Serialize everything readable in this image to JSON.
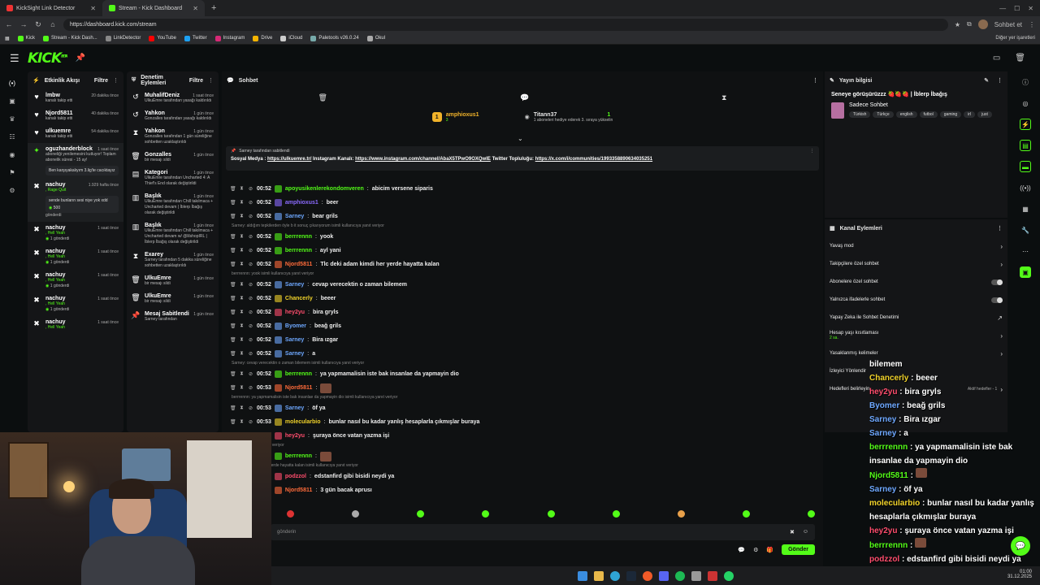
{
  "browser": {
    "tabs": [
      {
        "label": "KickSight Link Detector"
      },
      {
        "label": "Stream - Kick Dashboard"
      }
    ],
    "url": "https://dashboard.kick.com/stream",
    "profile_label": "Sohbet et",
    "bookmarks": [
      "Kick",
      "Stream - Kick Dash...",
      "LinkDetector",
      "YouTube",
      "Twitter",
      "Instagram",
      "Drive",
      "iCloud",
      "Paletools v26.0.24",
      "Okul"
    ],
    "bookmarks_right": "Diğer yer işaretleri"
  },
  "app": {
    "logo": "KICK",
    "logo_tag": "BETA"
  },
  "activity": {
    "title": "Etkinlik Akışı",
    "filter": "Filtre",
    "items": [
      {
        "name": "lmbw",
        "time": "20 dakika önce",
        "sub": "kanalı takip etti"
      },
      {
        "name": "Njord5811",
        "time": "40 dakika önce",
        "sub": "kanalı takip etti"
      },
      {
        "name": "ulkuemre",
        "time": "54 dakika önce",
        "sub": "kanalı takip etti"
      },
      {
        "name": "oguzhanderblock",
        "time": "1 saat önce",
        "sub": "aboneliği yenilemesini kutluyor! Toplam abonelik süresi - 15 ay!",
        "box": "Ben karşıyakalıyım 3.lig'te cacıktayız"
      },
      {
        "name": "nachuy",
        "time": "1.929 hafta önce",
        "sub": ", Rage Quit",
        "box": "sende bunların sesi niye yok xdd",
        "amount": "500",
        "sent": "gönderdi"
      },
      {
        "name": "nachuy",
        "time": "1 saat önce",
        "sub": ", Hell Yeah",
        "amount": "1",
        "sent": "gönderdi"
      },
      {
        "name": "nachuy",
        "time": "1 saat önce",
        "sub": ", Hell Yeah",
        "amount": "1",
        "sent": "gönderdi"
      },
      {
        "name": "nachuy",
        "time": "1 saat önce",
        "sub": ", Hell Yeah",
        "amount": "1",
        "sent": "gönderdi"
      },
      {
        "name": "nachuy",
        "time": "1 saat önce",
        "sub": ", Hell Yeah",
        "amount": "1",
        "sent": "gönderdi"
      },
      {
        "name": "nachuy",
        "time": "1 saat önce",
        "sub": ", Hell Yeah"
      }
    ]
  },
  "moderation": {
    "title": "Denetim Eylemleri",
    "filter": "Filtre",
    "items": [
      {
        "name": "MuhalifDeniz",
        "time": "1 saat önce",
        "sub": "UlkuEmre tarafından yasağı kaldırıldı"
      },
      {
        "name": "Yahkon",
        "time": "1 gün önce",
        "sub": "Gonzalles tarafından yasağı kaldırıldı"
      },
      {
        "name": "Yahkon",
        "time": "1 gün önce",
        "sub": "Gonzalles tarafından 1 gün süreliğine sohbetten uzaklaştırıldı"
      },
      {
        "name": "Gonzalles",
        "time": "1 gün önce",
        "sub": "bir mesajı sildi"
      },
      {
        "name": "Kategori",
        "time": "1 gün önce",
        "sub": "UlkuEmre tarafından Uncharted 4: A Thief's End olarak değiştirildi"
      },
      {
        "name": "Başlık",
        "time": "1 gün önce",
        "sub": "UlkuEmre tarafından Chill takılmaca + Uncharted devam | İblerp İbağış olarak değiştirildi"
      },
      {
        "name": "Başlık",
        "time": "1 gün önce",
        "sub": "UlkuEmre tarafından Chill takılmaca + Uncharted devam w/ @lilshopIRL | İblerp İbağış olarak değiştirildi"
      },
      {
        "name": "Exarey",
        "time": "1 gün önce",
        "sub": "Sarney tarafından 5 dakika süreliğine sohbetten uzaklaştırıldı"
      },
      {
        "name": "UlkuEmre",
        "time": "1 gün önce",
        "sub": "bir mesajı sildi"
      },
      {
        "name": "UlkuEmre",
        "time": "1 gün önce",
        "sub": "bir mesajı sildi"
      },
      {
        "name": "Mesaj Sabitlendi",
        "time": "1 gün önce",
        "sub": "Sarney tarafından"
      }
    ]
  },
  "chat": {
    "title": "Sohbet",
    "leaders": [
      {
        "name": "amphioxus1",
        "rank": "1",
        "value": "3"
      },
      {
        "name": "Titann37",
        "rank": "1",
        "sub": "1 aboneleri hediye ederek 3. sıraya yükselin"
      }
    ],
    "pinned": {
      "by": "Sarney tarafından sabitlendi",
      "prefix": "Sosyal Medya :",
      "link1": "https://ulkuemre.tr/",
      "mid": "Instagram Kanalı:",
      "link2": "https://www.instagram.com/channel/AbaX5TPwO9OXQwIE",
      "mid2": "Twitter Topluluğu:",
      "link3": "https://x.com/i/communities/1993358890634035251"
    },
    "messages": [
      {
        "time": "00:52",
        "user": "apoyusikenlerekondomveren",
        "color": "#53fc18",
        "text": "abicim versene siparis"
      },
      {
        "time": "00:52",
        "user": "amphioxus1",
        "color": "#8b6bff",
        "text": "beer"
      },
      {
        "time": "00:52",
        "user": "Sarney",
        "color": "#6ea8ff",
        "text": "bear grils"
      },
      {
        "reply": "Sarney: aldığım tepkilerden öyle b it sonuç çıkarıyorum isimli kullanıcıya yanıt veriyor"
      },
      {
        "time": "00:52",
        "user": "berrrennn",
        "color": "#53fc18",
        "text": "yook"
      },
      {
        "time": "00:52",
        "user": "berrrennn",
        "color": "#53fc18",
        "text": "ayl yani"
      },
      {
        "time": "00:52",
        "user": "Njord5811",
        "color": "#ff6b3a",
        "text": "Tlc deki adam kimdi her yerde hayatta kalan"
      },
      {
        "reply": "berrrennn: yook isimli kullanıcıya yanıt veriyor"
      },
      {
        "time": "00:52",
        "user": "Sarney",
        "color": "#6ea8ff",
        "text": "cevap verecektin o zaman bilemem"
      },
      {
        "time": "00:52",
        "user": "Chancerly",
        "color": "#f1d32a",
        "text": "beeer"
      },
      {
        "time": "00:52",
        "user": "hey2yu",
        "color": "#ff4d6d",
        "text": "bira gryls"
      },
      {
        "time": "00:52",
        "user": "Byomer",
        "color": "#6ea8ff",
        "text": "beağ grils"
      },
      {
        "time": "00:52",
        "user": "Sarney",
        "color": "#6ea8ff",
        "text": "Bira ızgar"
      },
      {
        "time": "00:52",
        "user": "Sarney",
        "color": "#6ea8ff",
        "text": "a"
      },
      {
        "reply": "Sarney: cevap verecektin o zaman bilemem isimli kullanıcıya yanıt veriyor"
      },
      {
        "time": "00:52",
        "user": "berrrennn",
        "color": "#53fc18",
        "text": "ya yapmamalisin iste bak insanlae da yapmayin dio"
      },
      {
        "time": "00:53",
        "user": "Njord5811",
        "color": "#ff6b3a",
        "text": ""
      },
      {
        "reply": "berrrennn: ya yapmamalisin iste bak insanlae da yapmayin dio isimli kullanıcıya yanıt veriyor"
      },
      {
        "time": "00:53",
        "user": "Sarney",
        "color": "#6ea8ff",
        "text": "öf ya"
      },
      {
        "time": "00:53",
        "user": "molecularbio",
        "color": "#f1d32a",
        "text": "bunlar nasıl bu kadar yanlış hesaplarla çıkmışlar buraya"
      },
      {
        "time": "00:53",
        "user": "hey2yu",
        "color": "#ff4d6d",
        "text": "şuraya önce vatan yazma işi"
      },
      {
        "reply": "isimli kullanıcıya yanıt veriyor"
      },
      {
        "time": "00:53",
        "user": "berrrennn",
        "color": "#53fc18",
        "text": ""
      },
      {
        "reply": "deki adam kimdi her yerde hayatta kalan isimli kullanıcıya yanıt veriyor"
      },
      {
        "time": "00:53",
        "user": "podzzol",
        "color": "#ff4d6d",
        "text": "edstanfird gibi bisidi neydi ya"
      },
      {
        "time": "00:53",
        "user": "Njord5811",
        "color": "#ff6b3a",
        "text": "3 gün bacak aprusı"
      }
    ],
    "input_placeholder": "gönderin",
    "send_label": "Gönder"
  },
  "stream_info": {
    "title": "Yayın bilgisi",
    "stream_title": "Seneye görüşürüzzz 🍓🍓🍓 | İblerp İbağış",
    "category": "Sadece Sohbet",
    "tags": [
      "Türkish",
      "Türkçe",
      "english",
      "futbol",
      "gaming",
      "irl",
      "just"
    ]
  },
  "channel_actions": {
    "title": "Kanal Eylemleri",
    "rows": [
      {
        "label": "Yavaş mod",
        "kind": "arrow"
      },
      {
        "label": "Takipçilere özel sohbet",
        "kind": "arrow"
      },
      {
        "label": "Abonelere özel sohbet",
        "kind": "toggle"
      },
      {
        "label": "Yalnızca ifadelerle sohbet",
        "kind": "toggle"
      },
      {
        "label": "Yapay Zeka ile Sohbet Denetimi",
        "kind": "link"
      },
      {
        "label": "Hesap yaşı kısıtlaması",
        "sub": "2 sa.",
        "kind": "arrow"
      },
      {
        "label": "Yasaklanmış kelimeler",
        "kind": "arrow"
      },
      {
        "label": "İzleyici Yönlendir",
        "kind": "none"
      },
      {
        "label": "Hedefleri belirleyin",
        "sub": "Aktif hedefler - 1",
        "kind": "arrow"
      }
    ]
  },
  "overlay_chat": [
    {
      "user": "",
      "text": "bilemem"
    },
    {
      "user": "Chancerly",
      "color": "#f1d32a",
      "text": "beeer"
    },
    {
      "user": "hey2yu",
      "color": "#ff4d6d",
      "text": "bira gryls"
    },
    {
      "user": "Byomer",
      "color": "#6ea8ff",
      "text": "beağ grils"
    },
    {
      "user": "Sarney",
      "color": "#6ea8ff",
      "text": "Bira ızgar"
    },
    {
      "user": "Sarney",
      "color": "#6ea8ff",
      "text": "a"
    },
    {
      "user": "berrrennn",
      "color": "#53fc18",
      "text": "ya yapmamalisin iste bak insanlae da yapmayin dio"
    },
    {
      "user": "Njord5811",
      "color": "#53fc18",
      "text": ""
    },
    {
      "user": "Sarney",
      "color": "#6ea8ff",
      "text": "öf ya"
    },
    {
      "user": "molecularbio",
      "color": "#f1d32a",
      "text": "bunlar nasıl bu kadar yanlış hesaplarla çıkmışlar buraya"
    },
    {
      "user": "hey2yu",
      "color": "#ff4d6d",
      "text": "şuraya önce vatan yazma işi"
    },
    {
      "user": "berrrennn",
      "color": "#53fc18",
      "text": ""
    },
    {
      "user": "podzzol",
      "color": "#ff4d6d",
      "text": "edstanfird gibi bisidi neydi ya"
    },
    {
      "user": "Njord5811",
      "color": "#53fc18",
      "text": "3 gün bacak aprusı"
    }
  ],
  "taskbar": {
    "time": "01:00",
    "date": "31.12.2025"
  },
  "colors": {
    "accent": "#53fc18",
    "background": "#0b0e0f",
    "panel": "#141517"
  }
}
